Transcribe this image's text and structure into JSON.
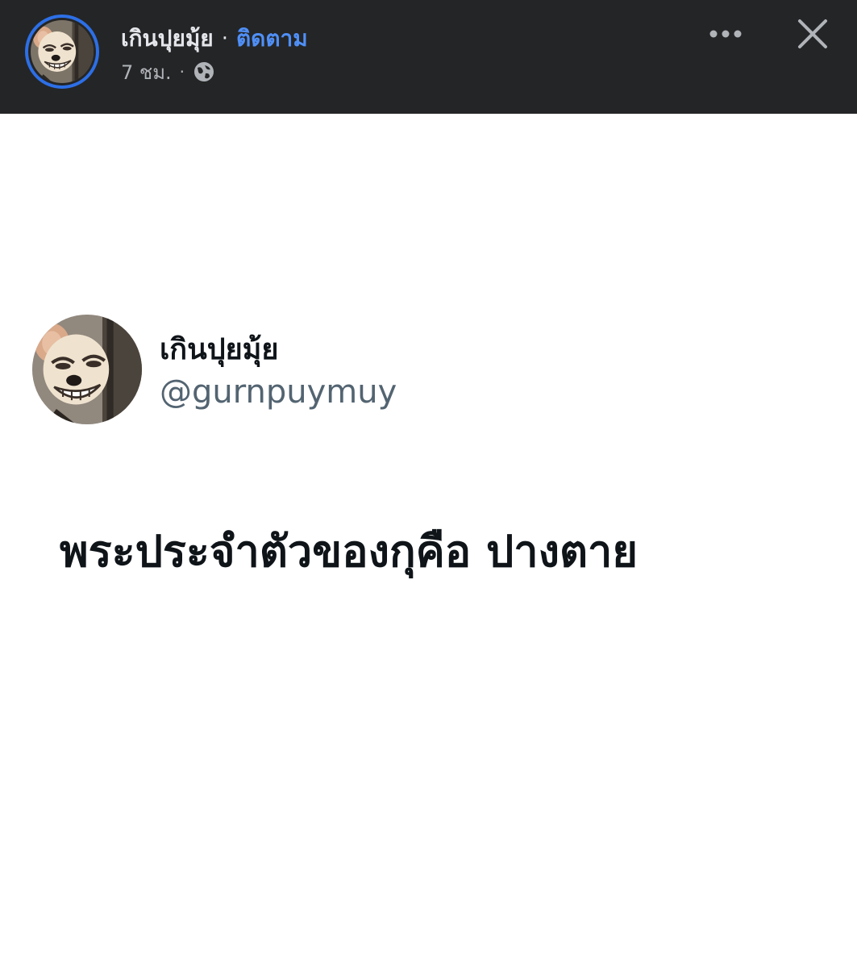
{
  "header": {
    "author_name": "เกินปุยมุ้ย",
    "separator": "·",
    "follow_label": "ติดตาม",
    "timestamp": "7 ชม.",
    "meta_separator": "·",
    "audience_icon": "globe-icon",
    "more_icon": "more-dots-icon",
    "close_icon": "close-icon"
  },
  "tweet": {
    "display_name": "เกินปุยมุ้ย",
    "handle": "@gurnpuymuy",
    "text": "พระประจำตัวของกุคือ ปางตาย"
  },
  "colors": {
    "topbar_bg": "#242526",
    "header_text": "#e4e6eb",
    "follow_link": "#4f8ff7",
    "meta_text": "#b0b3b8",
    "avatar_ring": "#2d6fe6",
    "tweet_text": "#0f1419",
    "handle_text": "#536471"
  }
}
